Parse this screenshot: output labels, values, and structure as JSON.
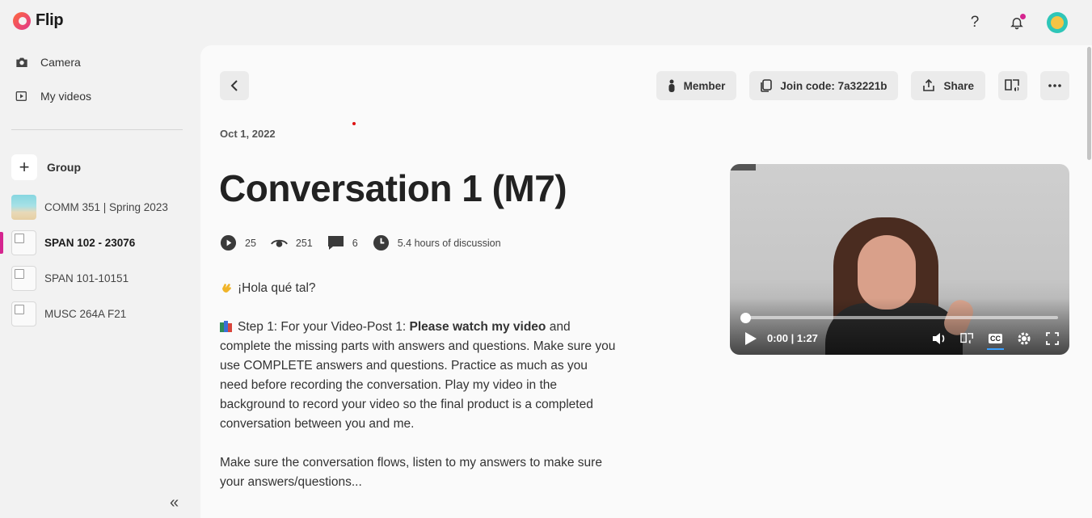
{
  "app": {
    "name": "Flip"
  },
  "header": {
    "help_label": "?"
  },
  "sidebar": {
    "nav": [
      {
        "label": "Camera",
        "icon": "camera-icon"
      },
      {
        "label": "My videos",
        "icon": "video-icon"
      }
    ],
    "group_add_label": "Group",
    "groups": [
      {
        "label": "COMM 351 | Spring 2023"
      },
      {
        "label": "SPAN 102 - 23076",
        "active": true
      },
      {
        "label": "SPAN 101-10151"
      },
      {
        "label": "MUSC 264A F21"
      }
    ],
    "collapse_label": "«"
  },
  "topic": {
    "actions": {
      "member_label": "Member",
      "join_code_label": "Join code: 7a32221b",
      "share_label": "Share"
    },
    "date": "Oct 1, 2022",
    "title": "Conversation 1 (M7)",
    "stats": {
      "responses": "25",
      "views": "251",
      "comments": "6",
      "discussion": "5.4 hours of discussion"
    },
    "body": {
      "greeting": "¡Hola qué tal?",
      "step1_prefix": "Step 1: For your Video-Post 1: ",
      "step1_bold": "Please watch my video",
      "step1_rest": " and complete the missing parts with answers and questions. Make sure you use COMPLETE answers and questions. Practice as much as you need before recording the conversation. Play my video in the background to record your video so the final product is a completed conversation between you and me.",
      "para2": "Make sure the conversation flows, listen to my answers to make sure your answers/questions..."
    },
    "video": {
      "time": "0:00 | 1:27",
      "progress": 0,
      "cc_label": "CC"
    }
  },
  "colors": {
    "accent": "#d5258f",
    "avatar_bg": "#2fc6b8"
  }
}
